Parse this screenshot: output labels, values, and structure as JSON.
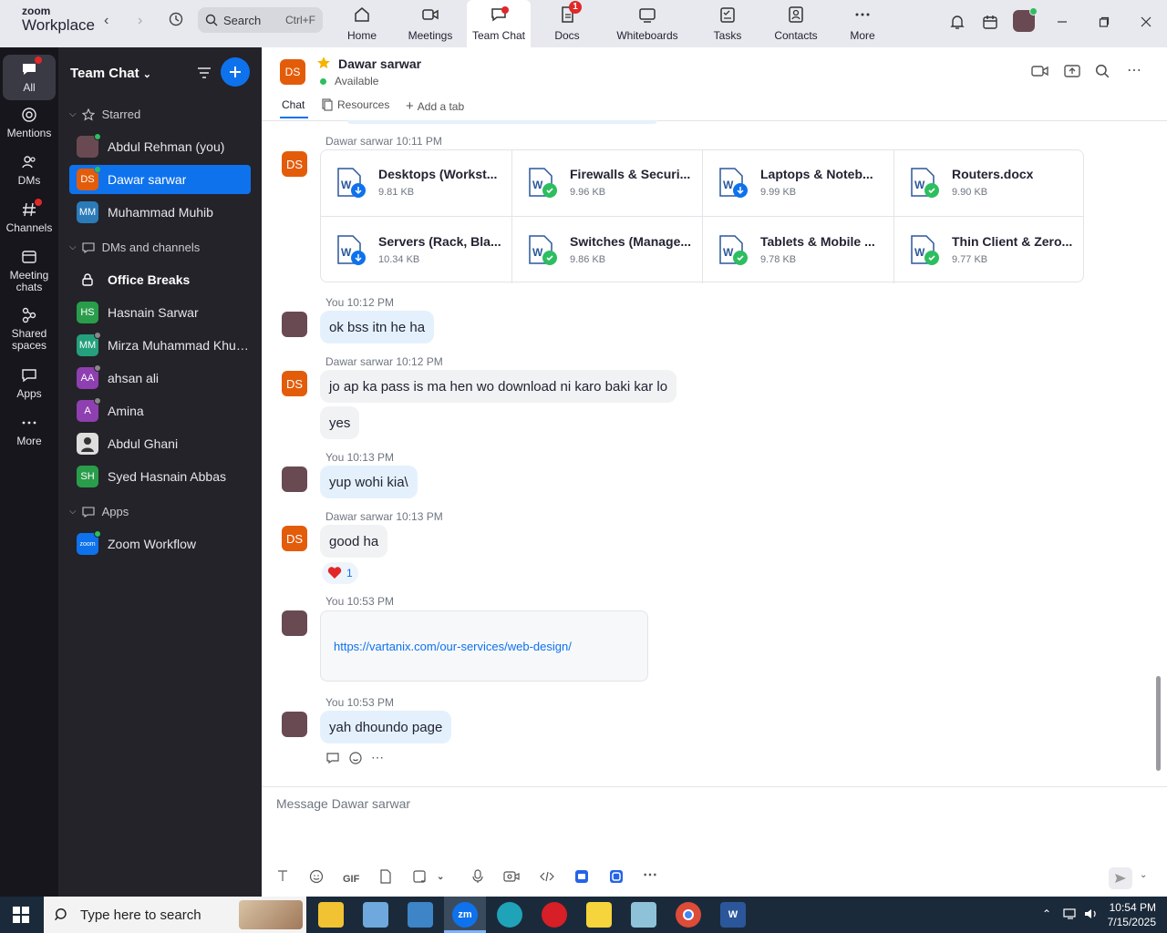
{
  "app": {
    "logo_line1": "zoom",
    "logo_line2": "Workplace"
  },
  "search": {
    "placeholder": "Search",
    "shortcut": "Ctrl+F"
  },
  "nav_tabs": [
    {
      "label": "Home"
    },
    {
      "label": "Meetings"
    },
    {
      "label": "Team Chat"
    },
    {
      "label": "Docs",
      "badge": "1"
    },
    {
      "label": "Whiteboards"
    },
    {
      "label": "Tasks"
    },
    {
      "label": "Contacts"
    },
    {
      "label": "More"
    }
  ],
  "rail": [
    {
      "label": "All"
    },
    {
      "label": "Mentions"
    },
    {
      "label": "DMs"
    },
    {
      "label": "Channels"
    },
    {
      "label": "Meeting chats"
    },
    {
      "label": "Shared spaces"
    },
    {
      "label": "Apps"
    },
    {
      "label": "More"
    }
  ],
  "sidebar": {
    "title": "Team Chat",
    "starred_label": "Starred",
    "starred": [
      {
        "name": "Abdul Rehman (you)",
        "initials": "",
        "color": "#6a4a52"
      },
      {
        "name": "Dawar sarwar",
        "initials": "DS",
        "color": "#e35c0a"
      },
      {
        "name": "Muhammad Muhib",
        "initials": "MM",
        "color": "#2b7bb9"
      }
    ],
    "dms_label": "DMs and channels",
    "dms": [
      {
        "name": "Office Breaks",
        "initials": "",
        "color": ""
      },
      {
        "name": "Hasnain Sarwar",
        "initials": "HS",
        "color": "#2a9d4b"
      },
      {
        "name": "Mirza Muhammad Khur...",
        "initials": "MM",
        "color": "#24a07d"
      },
      {
        "name": "ahsan ali",
        "initials": "AA",
        "color": "#8e3fb0"
      },
      {
        "name": "Amina",
        "initials": "A",
        "color": "#8e3fb0"
      },
      {
        "name": "Abdul Ghani",
        "initials": "",
        "color": "#ddd"
      },
      {
        "name": "Syed Hasnain Abbas",
        "initials": "SH",
        "color": "#2a9d4b"
      }
    ],
    "apps_label": "Apps",
    "apps": [
      {
        "name": "Zoom Workflow",
        "initials": "zoom",
        "color": "#0e72ed"
      }
    ]
  },
  "chat_header": {
    "initials": "DS",
    "name": "Dawar sarwar",
    "status": "Available",
    "tabs": {
      "chat": "Chat",
      "resources": "Resources",
      "add": "Add a tab"
    }
  },
  "messages": {
    "m1_meta": "Dawar sarwar 10:11 PM",
    "files": [
      {
        "name": "Desktops (Workst...",
        "size": "9.81 KB",
        "state": "download"
      },
      {
        "name": "Firewalls & Securi...",
        "size": "9.96 KB",
        "state": "done"
      },
      {
        "name": "Laptops & Noteb...",
        "size": "9.99 KB",
        "state": "download"
      },
      {
        "name": "Routers.docx",
        "size": "9.90 KB",
        "state": "done"
      },
      {
        "name": "Servers (Rack, Bla...",
        "size": "10.34 KB",
        "state": "download"
      },
      {
        "name": "Switches (Manage...",
        "size": "9.86 KB",
        "state": "done"
      },
      {
        "name": "Tablets & Mobile ...",
        "size": "9.78 KB",
        "state": "done"
      },
      {
        "name": "Thin Client & Zero...",
        "size": "9.77 KB",
        "state": "done"
      }
    ],
    "m2_meta": "You 10:12 PM",
    "m2_text": "ok bss itn  he ha",
    "m3_meta": "Dawar sarwar 10:12 PM",
    "m3_text": "jo ap ka pass is ma hen wo download ni karo baki kar lo",
    "m3b_text": "yes",
    "m4_meta": "You 10:13 PM",
    "m4_text": "yup wohi kia\\",
    "m5_meta": "Dawar sarwar 10:13 PM",
    "m5_text": "good ha",
    "reaction_count": "1",
    "m6_meta": "You 10:53 PM",
    "m6_link": "https://vartanix.com/our-services/web-design/",
    "m7_meta": "You 10:53 PM",
    "m7_text": "yah dhoundo page"
  },
  "composer": {
    "placeholder": "Message Dawar sarwar",
    "gif": "GIF"
  },
  "taskbar": {
    "search_placeholder": "Type here to search",
    "time": "10:54 PM",
    "date": "7/15/2025"
  }
}
